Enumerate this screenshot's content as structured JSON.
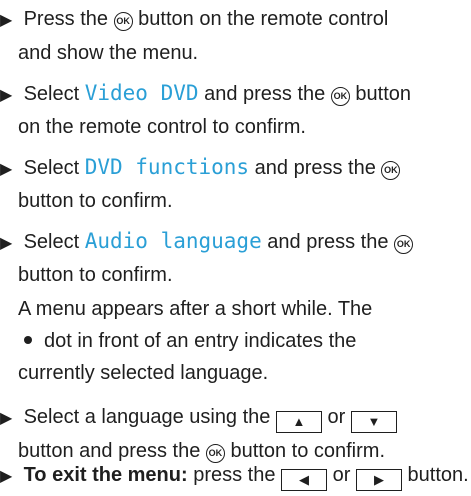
{
  "steps": [
    {
      "a": "Press the",
      "b": "button on the remote control",
      "c": "and show the menu."
    },
    {
      "a": "Select",
      "hl": "Video DVD",
      "b": "and press the",
      "c": "button",
      "d": "on the remote control to confirm."
    },
    {
      "a": "Select",
      "hl": "DVD functions",
      "b": "and press the",
      "c": "button to confirm."
    },
    {
      "a": "Select",
      "hl": "Audio language",
      "b": "and press the",
      "c": "button to confirm.",
      "d": "A menu appears after a short while. The",
      "e": "dot in front of an entry indicates the",
      "f": "currently selected language."
    },
    {
      "a": "Select a language using the",
      "b": "or",
      "c": "button and press the",
      "d": "button to confirm."
    },
    {
      "bold": "To exit the menu:",
      "a": "press the",
      "b": "or",
      "c": "button."
    }
  ],
  "icons": {
    "ok_label": "OK",
    "up": "up-arrow-key",
    "down": "down-arrow-key",
    "left": "left-arrow-key",
    "right": "right-arrow-key"
  },
  "colors": {
    "highlight": "#2a9fd6",
    "text": "#1f1f1f"
  }
}
